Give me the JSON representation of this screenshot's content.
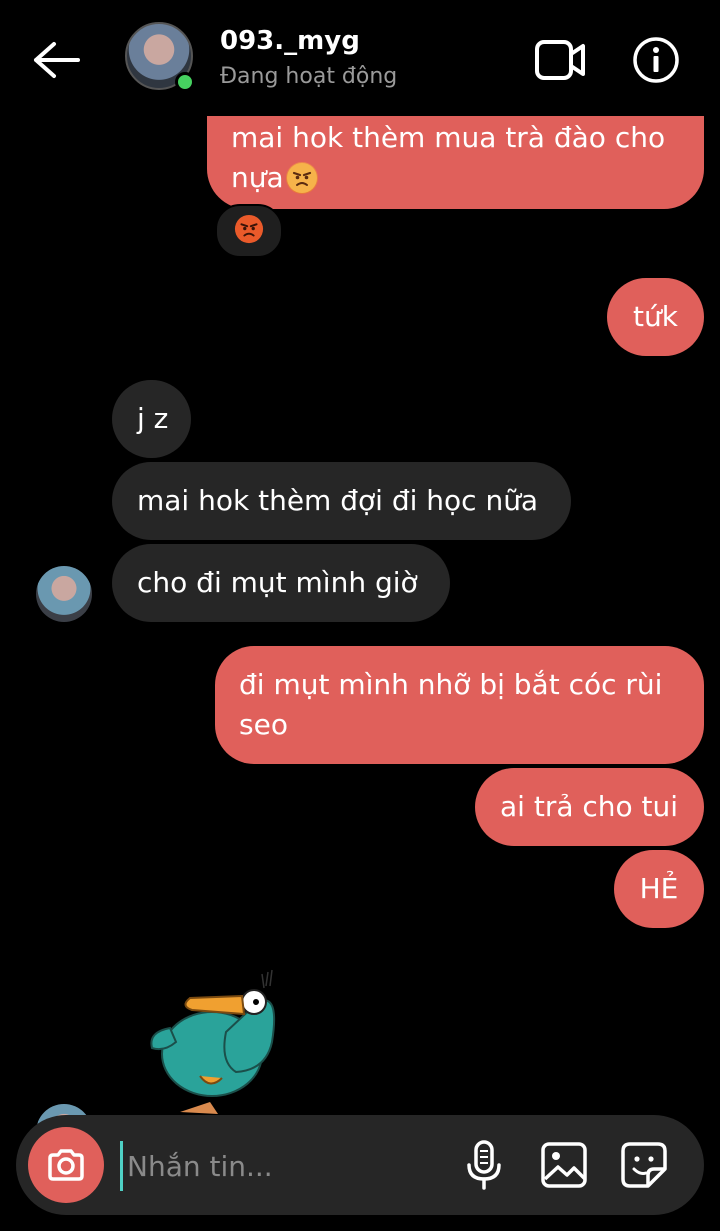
{
  "header": {
    "username": "093._myg",
    "status": "Đang hoạt động",
    "icons": {
      "back": "back-arrow-icon",
      "video": "video-call-icon",
      "info": "info-icon"
    }
  },
  "messages": [
    {
      "sender": "me",
      "lines": [
        "mai hok thèm mua trà đào cho",
        "nựa"
      ],
      "emoji": "angry-face"
    },
    {
      "sender": "me",
      "text": "tứk"
    },
    {
      "sender": "them",
      "text": "j z"
    },
    {
      "sender": "them",
      "text": "mai hok thèm đợi đi học nữa"
    },
    {
      "sender": "them",
      "text": "cho đi mụt mình giờ"
    },
    {
      "sender": "me",
      "lines": [
        "đi mụt mình nhỡ bị bắt cóc rùi",
        "seo"
      ]
    },
    {
      "sender": "me",
      "text": "ai trả cho tui"
    },
    {
      "sender": "me",
      "text": "HẺ"
    },
    {
      "sender": "them",
      "sticker": "platypus-sticker"
    }
  ],
  "reaction": {
    "emoji": "angry-face"
  },
  "composer": {
    "placeholder": "Nhắn tin...",
    "value": "",
    "icons": {
      "camera": "camera-icon",
      "mic": "microphone-icon",
      "gallery": "image-icon",
      "sticker": "sticker-icon"
    }
  },
  "colors": {
    "outgoing": "#e0605b",
    "incoming": "#262626",
    "online": "#46d160",
    "background": "#000000"
  }
}
